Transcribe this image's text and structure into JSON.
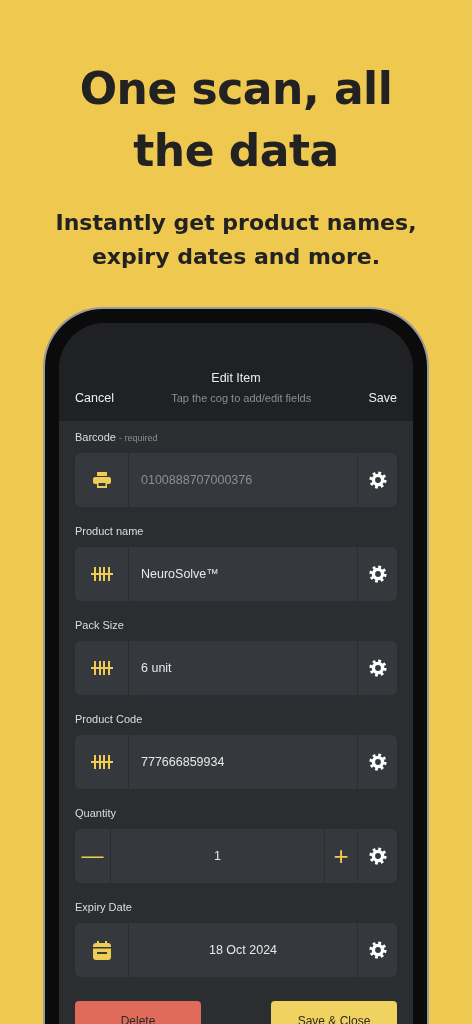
{
  "headline": "One scan, all the data",
  "subheadline": "Instantly get product names, expiry dates and more.",
  "nav": {
    "title": "Edit Item",
    "subtitle": "Tap the cog to add/edit fields",
    "cancel": "Cancel",
    "save": "Save"
  },
  "fields": [
    {
      "kind": "barcode",
      "label": "Barcode",
      "note": "- required",
      "placeholder": "0100888707000376"
    },
    {
      "kind": "text",
      "label": "Product name",
      "value": "NeuroSolve™"
    },
    {
      "kind": "text",
      "label": "Pack Size",
      "value": "6 unit"
    },
    {
      "kind": "text",
      "label": "Product Code",
      "value": "777666859934"
    },
    {
      "kind": "stepper",
      "label": "Quantity",
      "value": "1",
      "minus": "—",
      "plus": "+"
    },
    {
      "kind": "date",
      "label": "Expiry Date",
      "value": "18 Oct 2024"
    }
  ],
  "buttons": [
    {
      "kind": "danger",
      "label": "Delete"
    },
    {
      "kind": "primary",
      "label": "Save & Close"
    }
  ]
}
